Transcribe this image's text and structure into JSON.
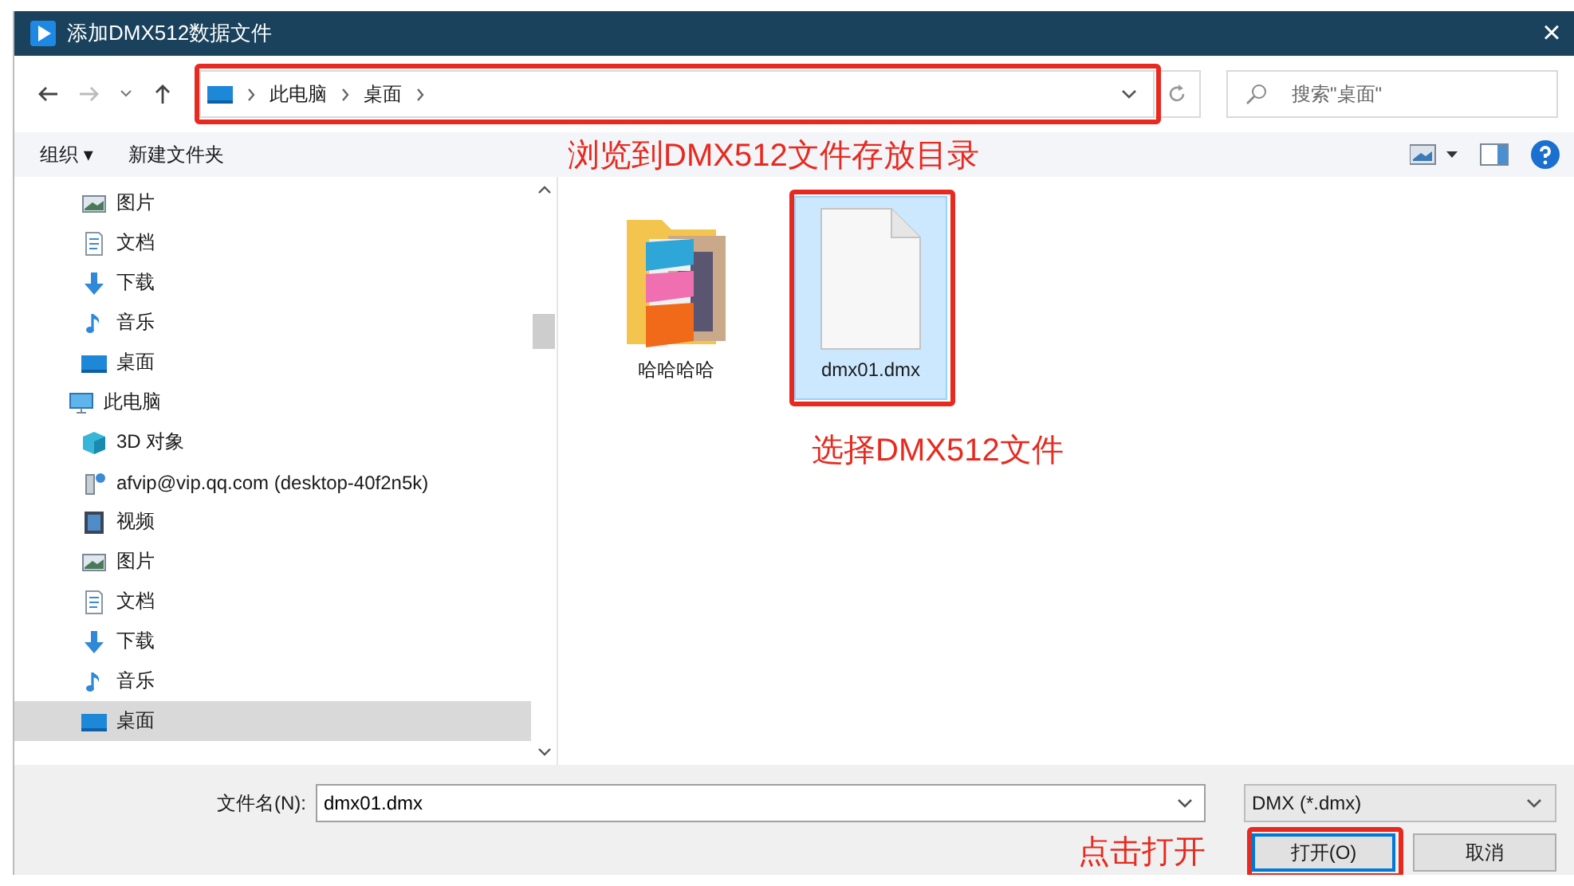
{
  "window": {
    "title": "添加DMX512数据文件",
    "close": "×"
  },
  "nav": {
    "breadcrumb": [
      "此电脑",
      "桌面"
    ],
    "search": {
      "placeholder": "搜索\"桌面\""
    }
  },
  "toolbar": {
    "organize": "组织 ▾",
    "new_folder": "新建文件夹"
  },
  "sidebar": {
    "items": [
      {
        "label": "图片",
        "kind": "picture",
        "selected": false
      },
      {
        "label": "文档",
        "kind": "document",
        "selected": false
      },
      {
        "label": "下载",
        "kind": "download",
        "selected": false
      },
      {
        "label": "音乐",
        "kind": "music",
        "selected": false
      },
      {
        "label": "桌面",
        "kind": "desktop",
        "selected": false
      },
      {
        "label": "此电脑",
        "kind": "pc",
        "selected": false,
        "children": [
          {
            "label": "3D 对象",
            "kind": "cube",
            "selected": false
          },
          {
            "label": "afvip@vip.qq.com (desktop-40f2n5k)",
            "kind": "network",
            "selected": false
          },
          {
            "label": "视频",
            "kind": "video",
            "selected": false
          },
          {
            "label": "图片",
            "kind": "picture",
            "selected": false
          },
          {
            "label": "文档",
            "kind": "document",
            "selected": false
          },
          {
            "label": "下载",
            "kind": "download",
            "selected": false
          },
          {
            "label": "音乐",
            "kind": "music",
            "selected": false
          },
          {
            "label": "桌面",
            "kind": "desktop",
            "selected": true
          }
        ]
      }
    ]
  },
  "files": [
    {
      "name": "哈哈哈哈",
      "kind": "folder",
      "selected": false
    },
    {
      "name": "dmx01.dmx",
      "kind": "file",
      "selected": true
    }
  ],
  "footer": {
    "filename_label": "文件名(N):",
    "filename": "dmx01.dmx",
    "filter": "DMX (*.dmx)",
    "open": "打开(O)",
    "cancel": "取消"
  },
  "annotations": {
    "address_note": "浏览到DMX512文件存放目录",
    "file_note": "选择DMX512文件",
    "open_note": "点击打开"
  }
}
